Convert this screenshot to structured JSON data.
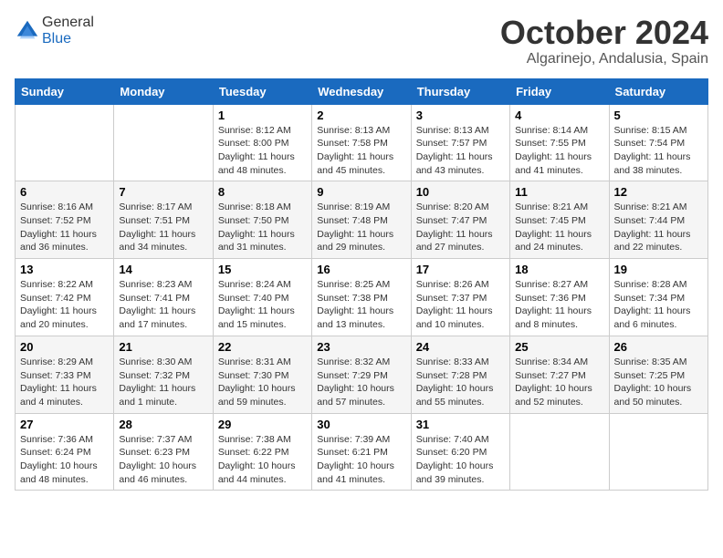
{
  "header": {
    "logo": {
      "general": "General",
      "blue": "Blue"
    },
    "title": "October 2024",
    "location": "Algarinejo, Andalusia, Spain"
  },
  "weekdays": [
    "Sunday",
    "Monday",
    "Tuesday",
    "Wednesday",
    "Thursday",
    "Friday",
    "Saturday"
  ],
  "weeks": [
    [
      {
        "day": null
      },
      {
        "day": null
      },
      {
        "day": 1,
        "sunrise": "Sunrise: 8:12 AM",
        "sunset": "Sunset: 8:00 PM",
        "daylight": "Daylight: 11 hours and 48 minutes."
      },
      {
        "day": 2,
        "sunrise": "Sunrise: 8:13 AM",
        "sunset": "Sunset: 7:58 PM",
        "daylight": "Daylight: 11 hours and 45 minutes."
      },
      {
        "day": 3,
        "sunrise": "Sunrise: 8:13 AM",
        "sunset": "Sunset: 7:57 PM",
        "daylight": "Daylight: 11 hours and 43 minutes."
      },
      {
        "day": 4,
        "sunrise": "Sunrise: 8:14 AM",
        "sunset": "Sunset: 7:55 PM",
        "daylight": "Daylight: 11 hours and 41 minutes."
      },
      {
        "day": 5,
        "sunrise": "Sunrise: 8:15 AM",
        "sunset": "Sunset: 7:54 PM",
        "daylight": "Daylight: 11 hours and 38 minutes."
      }
    ],
    [
      {
        "day": 6,
        "sunrise": "Sunrise: 8:16 AM",
        "sunset": "Sunset: 7:52 PM",
        "daylight": "Daylight: 11 hours and 36 minutes."
      },
      {
        "day": 7,
        "sunrise": "Sunrise: 8:17 AM",
        "sunset": "Sunset: 7:51 PM",
        "daylight": "Daylight: 11 hours and 34 minutes."
      },
      {
        "day": 8,
        "sunrise": "Sunrise: 8:18 AM",
        "sunset": "Sunset: 7:50 PM",
        "daylight": "Daylight: 11 hours and 31 minutes."
      },
      {
        "day": 9,
        "sunrise": "Sunrise: 8:19 AM",
        "sunset": "Sunset: 7:48 PM",
        "daylight": "Daylight: 11 hours and 29 minutes."
      },
      {
        "day": 10,
        "sunrise": "Sunrise: 8:20 AM",
        "sunset": "Sunset: 7:47 PM",
        "daylight": "Daylight: 11 hours and 27 minutes."
      },
      {
        "day": 11,
        "sunrise": "Sunrise: 8:21 AM",
        "sunset": "Sunset: 7:45 PM",
        "daylight": "Daylight: 11 hours and 24 minutes."
      },
      {
        "day": 12,
        "sunrise": "Sunrise: 8:21 AM",
        "sunset": "Sunset: 7:44 PM",
        "daylight": "Daylight: 11 hours and 22 minutes."
      }
    ],
    [
      {
        "day": 13,
        "sunrise": "Sunrise: 8:22 AM",
        "sunset": "Sunset: 7:42 PM",
        "daylight": "Daylight: 11 hours and 20 minutes."
      },
      {
        "day": 14,
        "sunrise": "Sunrise: 8:23 AM",
        "sunset": "Sunset: 7:41 PM",
        "daylight": "Daylight: 11 hours and 17 minutes."
      },
      {
        "day": 15,
        "sunrise": "Sunrise: 8:24 AM",
        "sunset": "Sunset: 7:40 PM",
        "daylight": "Daylight: 11 hours and 15 minutes."
      },
      {
        "day": 16,
        "sunrise": "Sunrise: 8:25 AM",
        "sunset": "Sunset: 7:38 PM",
        "daylight": "Daylight: 11 hours and 13 minutes."
      },
      {
        "day": 17,
        "sunrise": "Sunrise: 8:26 AM",
        "sunset": "Sunset: 7:37 PM",
        "daylight": "Daylight: 11 hours and 10 minutes."
      },
      {
        "day": 18,
        "sunrise": "Sunrise: 8:27 AM",
        "sunset": "Sunset: 7:36 PM",
        "daylight": "Daylight: 11 hours and 8 minutes."
      },
      {
        "day": 19,
        "sunrise": "Sunrise: 8:28 AM",
        "sunset": "Sunset: 7:34 PM",
        "daylight": "Daylight: 11 hours and 6 minutes."
      }
    ],
    [
      {
        "day": 20,
        "sunrise": "Sunrise: 8:29 AM",
        "sunset": "Sunset: 7:33 PM",
        "daylight": "Daylight: 11 hours and 4 minutes."
      },
      {
        "day": 21,
        "sunrise": "Sunrise: 8:30 AM",
        "sunset": "Sunset: 7:32 PM",
        "daylight": "Daylight: 11 hours and 1 minute."
      },
      {
        "day": 22,
        "sunrise": "Sunrise: 8:31 AM",
        "sunset": "Sunset: 7:30 PM",
        "daylight": "Daylight: 10 hours and 59 minutes."
      },
      {
        "day": 23,
        "sunrise": "Sunrise: 8:32 AM",
        "sunset": "Sunset: 7:29 PM",
        "daylight": "Daylight: 10 hours and 57 minutes."
      },
      {
        "day": 24,
        "sunrise": "Sunrise: 8:33 AM",
        "sunset": "Sunset: 7:28 PM",
        "daylight": "Daylight: 10 hours and 55 minutes."
      },
      {
        "day": 25,
        "sunrise": "Sunrise: 8:34 AM",
        "sunset": "Sunset: 7:27 PM",
        "daylight": "Daylight: 10 hours and 52 minutes."
      },
      {
        "day": 26,
        "sunrise": "Sunrise: 8:35 AM",
        "sunset": "Sunset: 7:25 PM",
        "daylight": "Daylight: 10 hours and 50 minutes."
      }
    ],
    [
      {
        "day": 27,
        "sunrise": "Sunrise: 7:36 AM",
        "sunset": "Sunset: 6:24 PM",
        "daylight": "Daylight: 10 hours and 48 minutes."
      },
      {
        "day": 28,
        "sunrise": "Sunrise: 7:37 AM",
        "sunset": "Sunset: 6:23 PM",
        "daylight": "Daylight: 10 hours and 46 minutes."
      },
      {
        "day": 29,
        "sunrise": "Sunrise: 7:38 AM",
        "sunset": "Sunset: 6:22 PM",
        "daylight": "Daylight: 10 hours and 44 minutes."
      },
      {
        "day": 30,
        "sunrise": "Sunrise: 7:39 AM",
        "sunset": "Sunset: 6:21 PM",
        "daylight": "Daylight: 10 hours and 41 minutes."
      },
      {
        "day": 31,
        "sunrise": "Sunrise: 7:40 AM",
        "sunset": "Sunset: 6:20 PM",
        "daylight": "Daylight: 10 hours and 39 minutes."
      },
      {
        "day": null
      },
      {
        "day": null
      }
    ]
  ]
}
